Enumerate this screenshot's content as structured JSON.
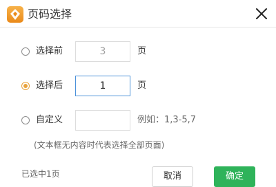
{
  "title": "页码选择",
  "icons": {
    "app": "app-logo-icon",
    "close": "close-icon"
  },
  "colors": {
    "accent": "#e8a23c",
    "confirm": "#2fb35a",
    "focus": "#4a90d9"
  },
  "options": [
    {
      "label": "选择前",
      "value": "3",
      "unit": "页",
      "selected": false,
      "disabled": true
    },
    {
      "label": "选择后",
      "value": "1",
      "unit": "页",
      "selected": true,
      "disabled": false
    },
    {
      "label": "自定义",
      "value": "",
      "example": "例如：1,3-5,7",
      "selected": false,
      "disabled": false
    }
  ],
  "note": "(文本框无内容时代表选择全部页面)",
  "status": "已选中1页",
  "buttons": {
    "cancel": "取消",
    "ok": "确定"
  }
}
